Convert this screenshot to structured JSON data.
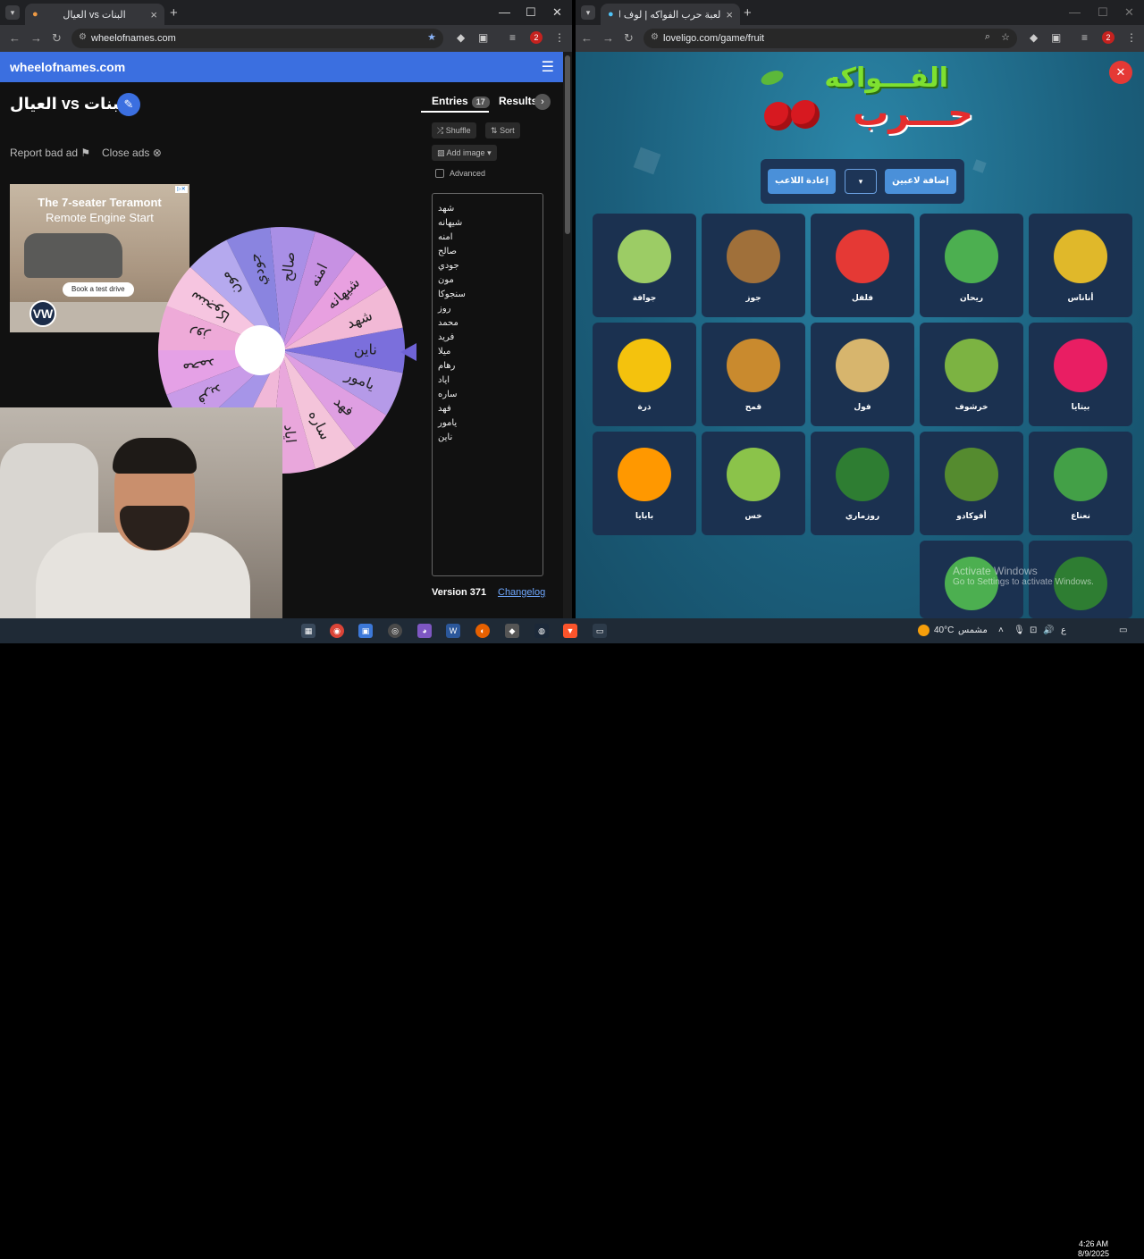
{
  "left_browser": {
    "tab_title": "العيال vs البنات",
    "url": "wheelofnames.com",
    "profile_badge": "2"
  },
  "right_browser": {
    "tab_title": "لعبة حرب الفواكه | لوف ليجو يوم…",
    "url": "loveligo.com/game/fruit",
    "profile_badge": "2"
  },
  "wheelofnames": {
    "brand": "wheelofnames.com",
    "wheel_title": "البنات vs العيال",
    "report_ad": "Report bad ad",
    "close_ads": "Close ads",
    "ad": {
      "headline": "The 7-seater Teramont",
      "subline": "Remote Engine Start",
      "cta": "Book a test drive",
      "logo": "VW"
    },
    "panel": {
      "entries_tab": "Entries",
      "entries_count": "17",
      "results_tab": "Results",
      "shuffle": "Shuffle",
      "sort": "Sort",
      "add_image": "Add image",
      "advanced": "Advanced",
      "version": "Version 371",
      "changelog": "Changelog"
    },
    "entries": [
      "شهد",
      "شيهانه",
      "امنه",
      "صالح",
      "جودي",
      "مون",
      "سنجوكا",
      "روز",
      "محمد",
      "فريد",
      "ميلا",
      "رهام",
      "اياد",
      "ساره",
      "فهد",
      "يامور",
      "ناين"
    ],
    "wheel_segments": [
      {
        "label": "ناين",
        "color": "#7b6fdc"
      },
      {
        "label": "شهد",
        "color": "#f2b9d6"
      },
      {
        "label": "شيهانه",
        "color": "#e8a0e0"
      },
      {
        "label": "امنه",
        "color": "#c791e3"
      },
      {
        "label": "صالح",
        "color": "#a98fe6"
      },
      {
        "label": "جودي",
        "color": "#8a84e0"
      },
      {
        "label": "مون",
        "color": "#b5a9ee"
      },
      {
        "label": "سنجوكا",
        "color": "#f6c5e0"
      },
      {
        "label": "روز",
        "color": "#eeaad8"
      },
      {
        "label": "محمد",
        "color": "#e5a1e6"
      },
      {
        "label": "فريد",
        "color": "#c89be8"
      },
      {
        "label": "ميلا",
        "color": "#a695e8"
      },
      {
        "label": "رهام",
        "color": "#f1b8d8"
      },
      {
        "label": "اياد",
        "color": "#e9a7dc"
      },
      {
        "label": "ساره",
        "color": "#f4c4da"
      },
      {
        "label": "فهد",
        "color": "#df9fe2"
      },
      {
        "label": "يامور",
        "color": "#b59ae8"
      }
    ]
  },
  "fruit_game": {
    "logo_top": "الفـــواكه",
    "logo_bottom": "حـــرب",
    "reset_players": "إعادة اللاعب",
    "add_players": "إضافة لاعبين",
    "player_select": "▾",
    "cards": [
      {
        "name": "أناناس",
        "icon": "pineapple-icon",
        "color": "#e0b82a"
      },
      {
        "name": "ريحان",
        "icon": "basil-icon",
        "color": "#4caf50"
      },
      {
        "name": "فلفل",
        "icon": "pepper-icon",
        "color": "#e53935"
      },
      {
        "name": "جوز",
        "icon": "walnut-icon",
        "color": "#a0703a"
      },
      {
        "name": "جوافة",
        "icon": "guava-icon",
        "color": "#9ccc65"
      },
      {
        "name": "بيتايا",
        "icon": "pitaya-icon",
        "color": "#e91e63"
      },
      {
        "name": "خرشوف",
        "icon": "artichoke-icon",
        "color": "#7cb342"
      },
      {
        "name": "فول",
        "icon": "beans-icon",
        "color": "#d7b56d"
      },
      {
        "name": "قمح",
        "icon": "wheat-icon",
        "color": "#c98a2e"
      },
      {
        "name": "ذرة",
        "icon": "corn-icon",
        "color": "#f4c20d"
      },
      {
        "name": "نعناع",
        "icon": "mint-icon",
        "color": "#43a047"
      },
      {
        "name": "أفوكادو",
        "icon": "avocado-icon",
        "color": "#558b2f"
      },
      {
        "name": "روزماري",
        "icon": "rosemary-icon",
        "color": "#2e7d32"
      },
      {
        "name": "خس",
        "icon": "lettuce-icon",
        "color": "#8bc34a"
      },
      {
        "name": "بابايا",
        "icon": "papaya-icon",
        "color": "#ff9800"
      },
      {
        "name": "",
        "icon": "rosemary-icon",
        "color": "#2e7d32"
      },
      {
        "name": "",
        "icon": "arugula-icon",
        "color": "#4caf50"
      }
    ],
    "watermark_title": "Activate Windows",
    "watermark_sub": "Go to Settings to activate Windows."
  },
  "taskbar": {
    "temperature": "40°C",
    "weather": "مشمس",
    "lang": "ع",
    "time": "4:26 AM",
    "date": "8/9/2025"
  }
}
